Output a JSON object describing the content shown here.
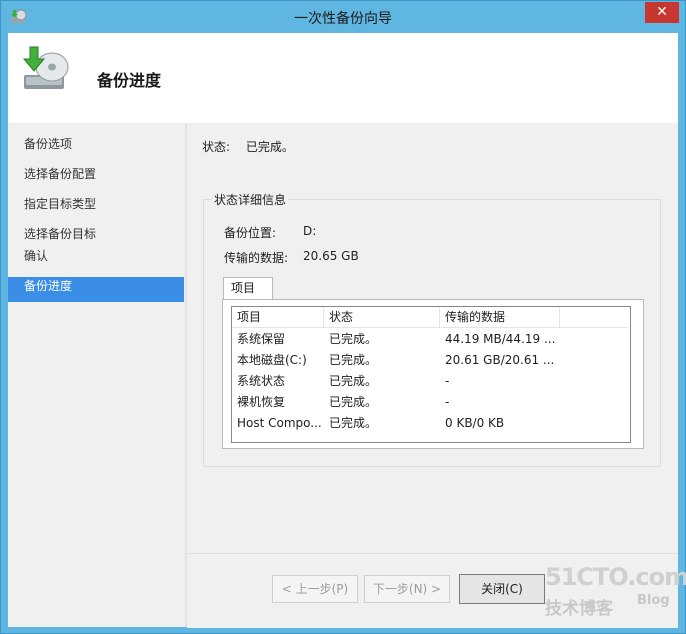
{
  "window": {
    "title": "一次性备份向导",
    "close_glyph": "✕"
  },
  "header": {
    "title": "备份进度",
    "icon": "backup-disk-icon"
  },
  "sidebar": {
    "items": [
      {
        "label": "备份选项"
      },
      {
        "label": "选择备份配置"
      },
      {
        "label": "指定目标类型"
      },
      {
        "label": "选择备份目标"
      },
      {
        "label": "确认"
      },
      {
        "label": "备份进度",
        "active": true
      }
    ]
  },
  "status": {
    "label": "状态:",
    "value": "已完成。"
  },
  "details": {
    "group_title": "状态详细信息",
    "location_label": "备份位置:",
    "location_value": "D:",
    "transferred_label": "传输的数据:",
    "transferred_value": "20.65 GB"
  },
  "tab": {
    "label": "项目"
  },
  "table": {
    "columns": [
      "项目",
      "状态",
      "传输的数据"
    ],
    "rows": [
      [
        "系统保留",
        "已完成。",
        "44.19 MB/44.19 ..."
      ],
      [
        "本地磁盘(C:)",
        "已完成。",
        "20.61 GB/20.61 ..."
      ],
      [
        "系统状态",
        "已完成。",
        "-"
      ],
      [
        "裸机恢复",
        "已完成。",
        "-"
      ],
      [
        "Host Compo...",
        "已完成。",
        "0 KB/0 KB"
      ]
    ]
  },
  "buttons": {
    "prev": "< 上一步(P)",
    "next": "下一步(N) >",
    "close": "关闭(C)"
  },
  "watermark": {
    "main": "51CTO.com",
    "sub": "技术博客",
    "blog": "Blog"
  },
  "colors": {
    "titlebar": "#5fb6e0",
    "accent": "#3a8ee6",
    "close": "#c7372f"
  }
}
